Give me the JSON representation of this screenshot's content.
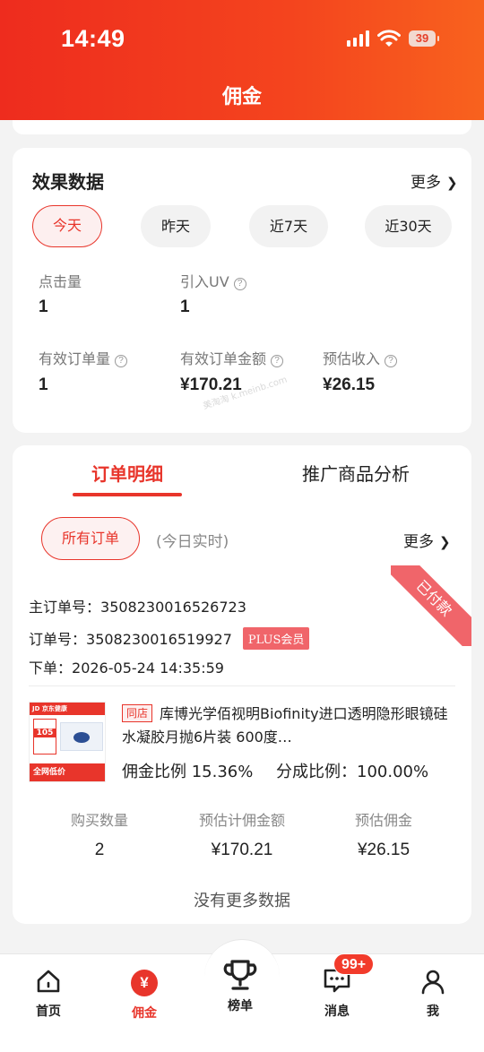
{
  "status_bar": {
    "time": "14:49",
    "battery": "39"
  },
  "page_title": "佣金",
  "effect": {
    "title": "效果数据",
    "more": "更多",
    "chips": [
      "今天",
      "昨天",
      "近7天",
      "近30天"
    ],
    "metrics": [
      {
        "label": "点击量",
        "value": "1"
      },
      {
        "label": "引入UV",
        "value": "1"
      },
      {
        "label": "有效订单量",
        "value": "1"
      },
      {
        "label": "有效订单金额",
        "value": "¥170.21"
      },
      {
        "label": "预估收入",
        "value": "¥26.15"
      }
    ],
    "watermark": "美淘淘 k.meinb.com"
  },
  "orders": {
    "tabs": [
      "订单明细",
      "推广商品分析"
    ],
    "filter": "所有订单",
    "filter_note": "(今日实时)",
    "more": "更多",
    "status_ribbon": "已付款",
    "main_order_label": "主订单号：",
    "main_order_no": "3508230016526723",
    "order_label": "订单号：",
    "order_no": "3508230016519927",
    "plus_badge": "PLUS会员",
    "placed_label": "下单：",
    "placed_time": "2026-05-24 14:35:59",
    "product": {
      "store_tag": "同店",
      "name": "库博光学佰视明Biofinity进口透明隐形眼镜硅水凝胶月抛6片装 600度…",
      "commission_rate": "佣金比例 15.36%",
      "share_rate": "分成比例：100.00%",
      "thumb_brand": "JD 京东健康",
      "thumb_number": "105",
      "thumb_slogan": "全网低价"
    },
    "stats": [
      {
        "label": "购买数量",
        "value": "2"
      },
      {
        "label": "预估计佣金额",
        "value": "¥170.21"
      },
      {
        "label": "预估佣金",
        "value": "¥26.15"
      }
    ],
    "no_more": "没有更多数据"
  },
  "nav": {
    "items": [
      "首页",
      "佣金",
      "榜单",
      "消息",
      "我"
    ],
    "yen_glyph": "¥",
    "badge": "99+"
  },
  "colors": {
    "accent": "#e8352b",
    "header_start": "#ee2c1e",
    "header_end": "#f8621e",
    "ribbon": "#f0656a"
  }
}
